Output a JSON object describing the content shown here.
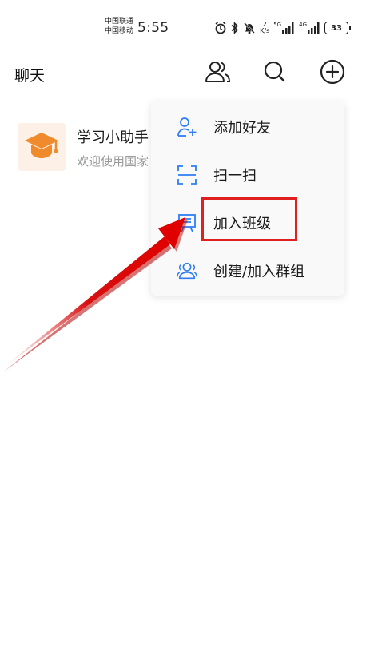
{
  "status_bar": {
    "carrier_1": "中国联通",
    "carrier_2": "中国移动",
    "time": "5:55",
    "net_speed_value": "2",
    "net_speed_unit": "K/s",
    "network_1": "5G",
    "network_2": "4G",
    "battery": "33",
    "icons": [
      "alarm-icon",
      "bluetooth-icon",
      "mute-icon",
      "signal-icon",
      "signal-icon",
      "battery-icon"
    ]
  },
  "header": {
    "title": "聊天",
    "icons": [
      "contacts-icon",
      "search-icon",
      "add-icon"
    ]
  },
  "chat_list": [
    {
      "title": "学习小助手",
      "preview": "欢迎使用国家",
      "avatar_icon": "graduation-cap-icon",
      "avatar_color": "#ef8b2c"
    }
  ],
  "popup_menu": {
    "items": [
      {
        "label": "添加好友",
        "icon": "add-friend-icon"
      },
      {
        "label": "扫一扫",
        "icon": "scan-icon"
      },
      {
        "label": "加入班级",
        "icon": "join-class-icon"
      },
      {
        "label": "创建/加入群组",
        "icon": "group-icon"
      }
    ],
    "icon_color": "#2f7df6"
  },
  "annotation": {
    "highlight_color": "#e02020",
    "highlighted_item": "加入班级"
  }
}
